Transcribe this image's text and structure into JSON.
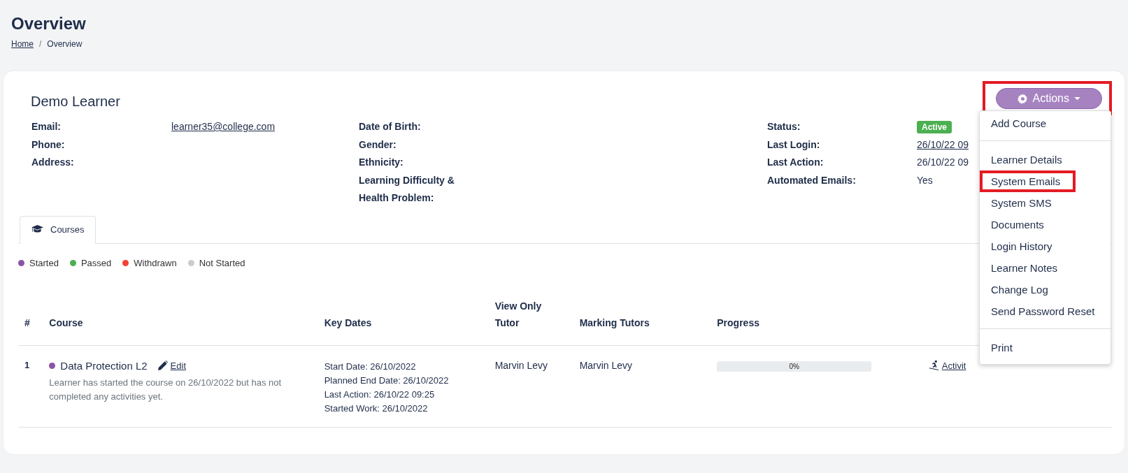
{
  "page": {
    "title": "Overview",
    "breadcrumb": [
      {
        "label": "Home",
        "kind": "link"
      },
      {
        "label": "/",
        "kind": "separator"
      },
      {
        "label": "Overview",
        "kind": "current"
      }
    ]
  },
  "learner": {
    "name": "Demo Learner"
  },
  "actions": {
    "label": "Actions",
    "highlighted": true
  },
  "info_columns": [
    [
      {
        "label": "Email:",
        "value": "learner35@college.com",
        "kind": "link"
      },
      {
        "label": "Phone:"
      },
      {
        "label": "Address:"
      }
    ],
    [
      {
        "label": "Date of Birth:"
      },
      {
        "label": "Gender:"
      },
      {
        "label": "Ethnicity:"
      },
      {
        "label": "Learning Difficulty & Health Problem:"
      }
    ],
    [
      {
        "label": "Status:",
        "value": "Active",
        "kind": "badge"
      },
      {
        "label": "Last Login:",
        "value": "26/10/22 09",
        "kind": "link"
      },
      {
        "label": "Last Action:",
        "value": "26/10/22 09",
        "kind": "text"
      },
      {
        "label": "Automated Emails:",
        "value": "Yes",
        "kind": "text"
      }
    ]
  ],
  "tabs": [
    {
      "label": "Courses",
      "selected": true
    }
  ],
  "legend": [
    {
      "label": "Started",
      "color": "#8a54a6"
    },
    {
      "label": "Passed",
      "color": "#4caf50"
    },
    {
      "label": "Withdrawn",
      "color": "#f44336"
    },
    {
      "label": "Not Started",
      "color": "#cccccc"
    }
  ],
  "table": {
    "columns": [
      "#",
      "Course",
      "Key Dates",
      "View Only Tutor",
      "Marking Tutors",
      "Progress"
    ],
    "rows": [
      {
        "number": "1",
        "course": "Data Protection L2",
        "color": "#8a54a6",
        "edit": "Edit",
        "note": "Learner has started the course on 26/10/2022 but has not completed any activities yet.",
        "key_dates": [
          "Start Date: 26/10/2022",
          "Planned End Date: 26/10/2022",
          "Last Action: 26/10/22 09:25",
          "Started Work: 26/10/2022"
        ],
        "view_only_tutor": "Marvin Levy",
        "marking_tutors": "Marvin Levy",
        "progress": {
          "level": 0,
          "reading": "0%"
        },
        "link": "Activit"
      }
    ]
  },
  "menu": [
    {
      "label": "Add Course",
      "highlighted": false,
      "divider_after": true
    },
    {
      "label": "Learner Details",
      "highlighted": false,
      "divider_after": false
    },
    {
      "label": "System Emails",
      "highlighted": true,
      "divider_after": false
    },
    {
      "label": "System SMS",
      "highlighted": false,
      "divider_after": false
    },
    {
      "label": "Documents",
      "highlighted": false,
      "divider_after": false
    },
    {
      "label": "Login History",
      "highlighted": false,
      "divider_after": false
    },
    {
      "label": "Learner Notes",
      "highlighted": false,
      "divider_after": false
    },
    {
      "label": "Change Log",
      "highlighted": false,
      "divider_after": false
    },
    {
      "label": "Send Password Reset",
      "highlighted": false,
      "divider_after": true
    },
    {
      "label": "Print",
      "highlighted": false,
      "divider_after": false
    }
  ]
}
